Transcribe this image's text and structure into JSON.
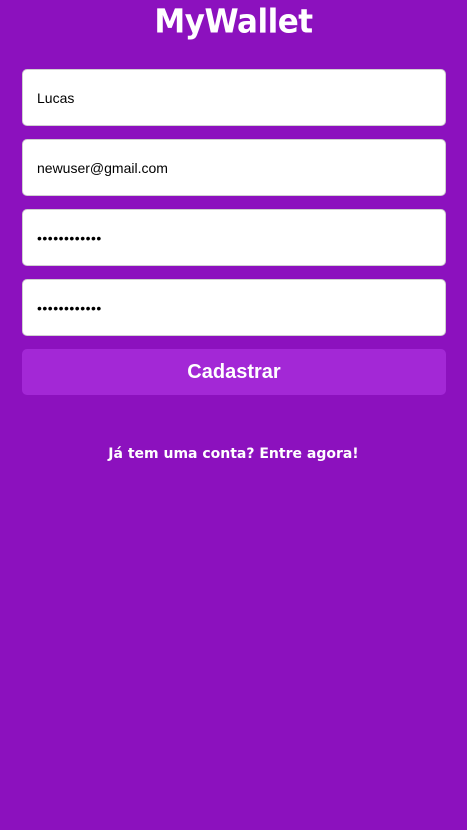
{
  "app": {
    "logo": "MyWallet"
  },
  "form": {
    "name_value": "Lucas",
    "email_value": "newuser@gmail.com",
    "password_value": "passwordabc1",
    "confirm_password_value": "passwordabc1",
    "submit_label": "Cadastrar"
  },
  "footer": {
    "login_link": "Já tem uma conta? Entre agora!"
  },
  "colors": {
    "background": "#8c11be",
    "button": "#a328d6",
    "input_bg": "#ffffff",
    "text_light": "#ffffff"
  }
}
